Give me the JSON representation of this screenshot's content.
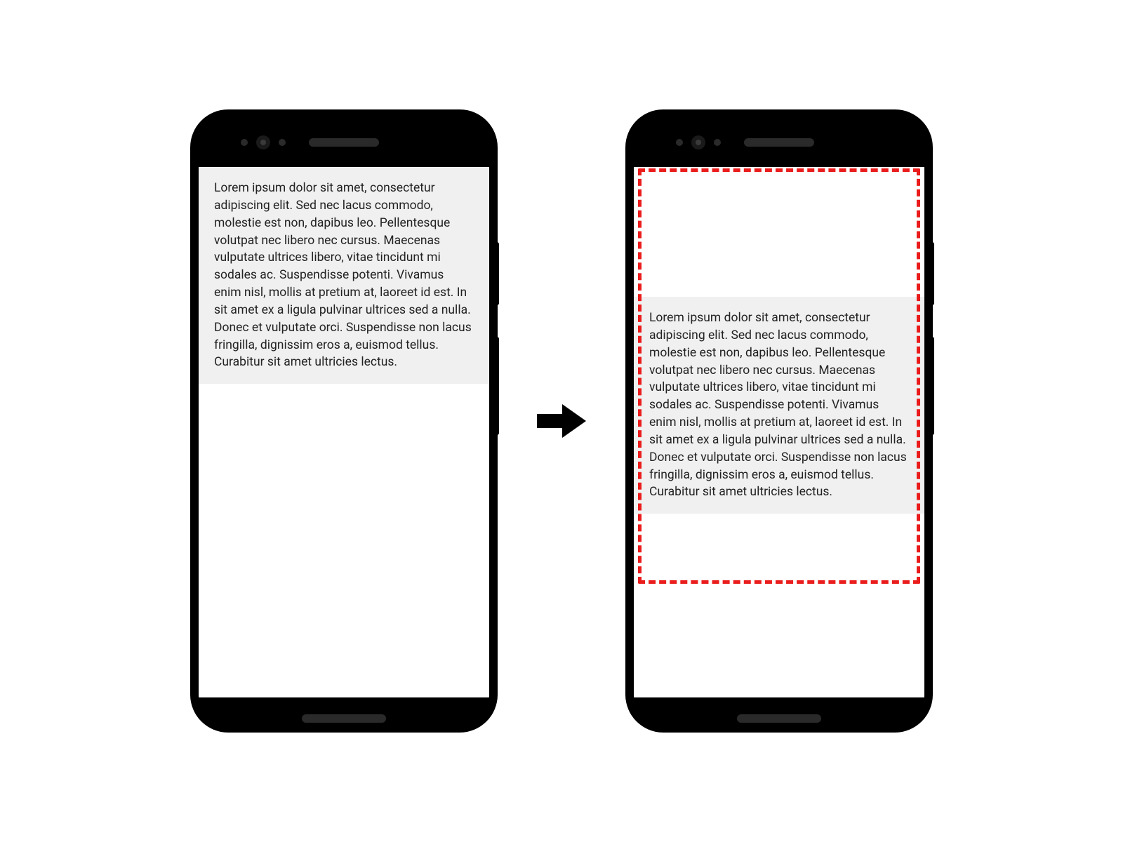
{
  "lorem_text": "Lorem ipsum dolor sit amet, consectetur adipiscing elit. Sed nec lacus commodo, molestie est non, dapibus leo. Pellentesque volutpat nec libero nec cursus. Maecenas vulputate ultrices libero, vitae tincidunt mi sodales ac. Suspendisse potenti. Vivamus enim nisl, mollis at pretium at, laoreet id est. In sit amet ex a ligula pulvinar ultrices sed a nulla. Donec et vulputate orci. Suspendisse non lacus fringilla, dignissim eros a, euismod tellus. Curabitur sit amet ultricies lectus.",
  "colors": {
    "highlight_border": "#ea1c1c",
    "text_block_bg": "#f0f0f0"
  }
}
